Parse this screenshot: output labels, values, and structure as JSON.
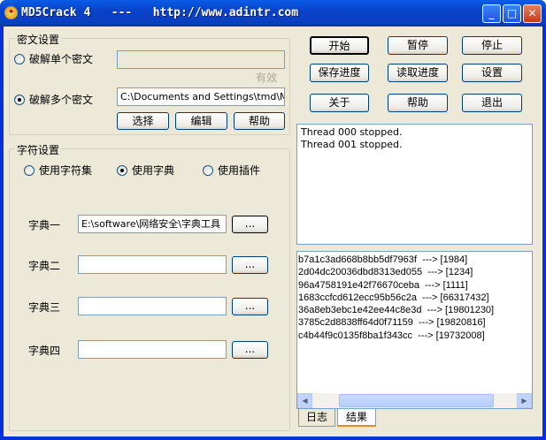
{
  "window": {
    "title": "MD5Crack 4   ---   http://www.adintr.com",
    "minimize": "_",
    "maximize": "□",
    "close": "✕"
  },
  "cipher_group": {
    "title": "密文设置",
    "single_label": "破解单个密文",
    "single_value": "",
    "valid_label": "有效",
    "multi_label": "破解多个密文",
    "multi_value": "C:\\Documents and Settings\\tmd\\My Dc",
    "selected": "multi",
    "buttons": {
      "choose": "选择",
      "edit": "编辑",
      "help": "帮助"
    }
  },
  "charset_group": {
    "title": "字符设置",
    "options": [
      "使用字符集",
      "使用字典",
      "使用插件"
    ],
    "selected": 1,
    "dicts": [
      {
        "label": "字典一",
        "value": "E:\\software\\网络安全\\字典工具",
        "browse": "..."
      },
      {
        "label": "字典二",
        "value": "",
        "browse": "..."
      },
      {
        "label": "字典三",
        "value": "",
        "browse": "..."
      },
      {
        "label": "字典四",
        "value": "",
        "browse": "..."
      }
    ]
  },
  "controls": {
    "start": "开始",
    "pause": "暂停",
    "stop": "停止",
    "save_progress": "保存进度",
    "load_progress": "读取进度",
    "settings": "设置",
    "about": "关于",
    "help": "帮助",
    "exit": "退出"
  },
  "log": [
    "Thread 000 stopped.",
    "Thread 001 stopped."
  ],
  "results": [
    "b7a1c3ad668b8bb5df7963f  ---> [1984]",
    "2d04dc20036dbd8313ed055  ---> [1234]",
    "96a4758191e42f76670ceba  ---> [1111]",
    "1683ccfcd612ecc95b56c2a  ---> [66317432]",
    "36a8eb3ebc1e42ee44c8e3d  ---> [19801230]",
    "3785c2d8838ff64d0f71159  ---> [19820816]",
    "c4b44f9c0135f8ba1f343cc  ---> [19732008]"
  ],
  "tabs": [
    "日志",
    "结果"
  ]
}
